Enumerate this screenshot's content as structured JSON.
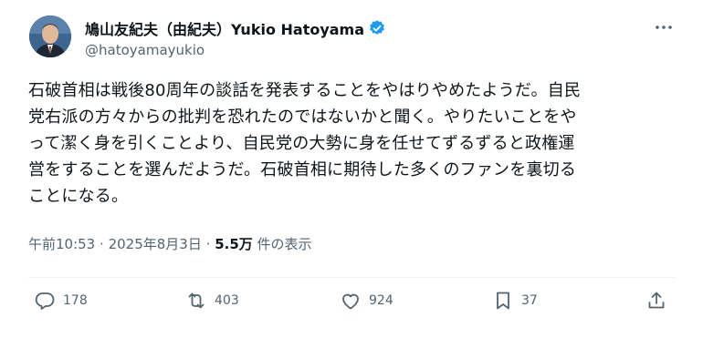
{
  "author": {
    "display_name": "鳩山友紀夫（由紀夫）Yukio Hatoyama",
    "handle": "@hatoyamayukio",
    "verified_color": "#1d9bf0"
  },
  "tweet": {
    "lines": [
      "石破首相は戦後80周年の談話を発表することをやはりやめたようだ。自民",
      "党右派の方々からの批判を恐れたのではないかと聞く。やりたいことをや",
      "って潔く身を引くことより、自民党の大勢に身を任せてずるずると政権運",
      "営をすることを選んだようだ。石破首相に期待した多くのファンを裏切る",
      "ことになる。"
    ]
  },
  "meta": {
    "time": "午前10:53",
    "separator": "·",
    "date": "2025年8月3日",
    "views_count": "5.5万",
    "views_label": "件の表示"
  },
  "actions": {
    "replies": "178",
    "reposts": "403",
    "likes": "924",
    "bookmarks": "37"
  },
  "icons": [
    "more-icon",
    "verified-badge-icon",
    "reply-icon",
    "repost-icon",
    "like-icon",
    "bookmark-icon",
    "share-icon"
  ]
}
